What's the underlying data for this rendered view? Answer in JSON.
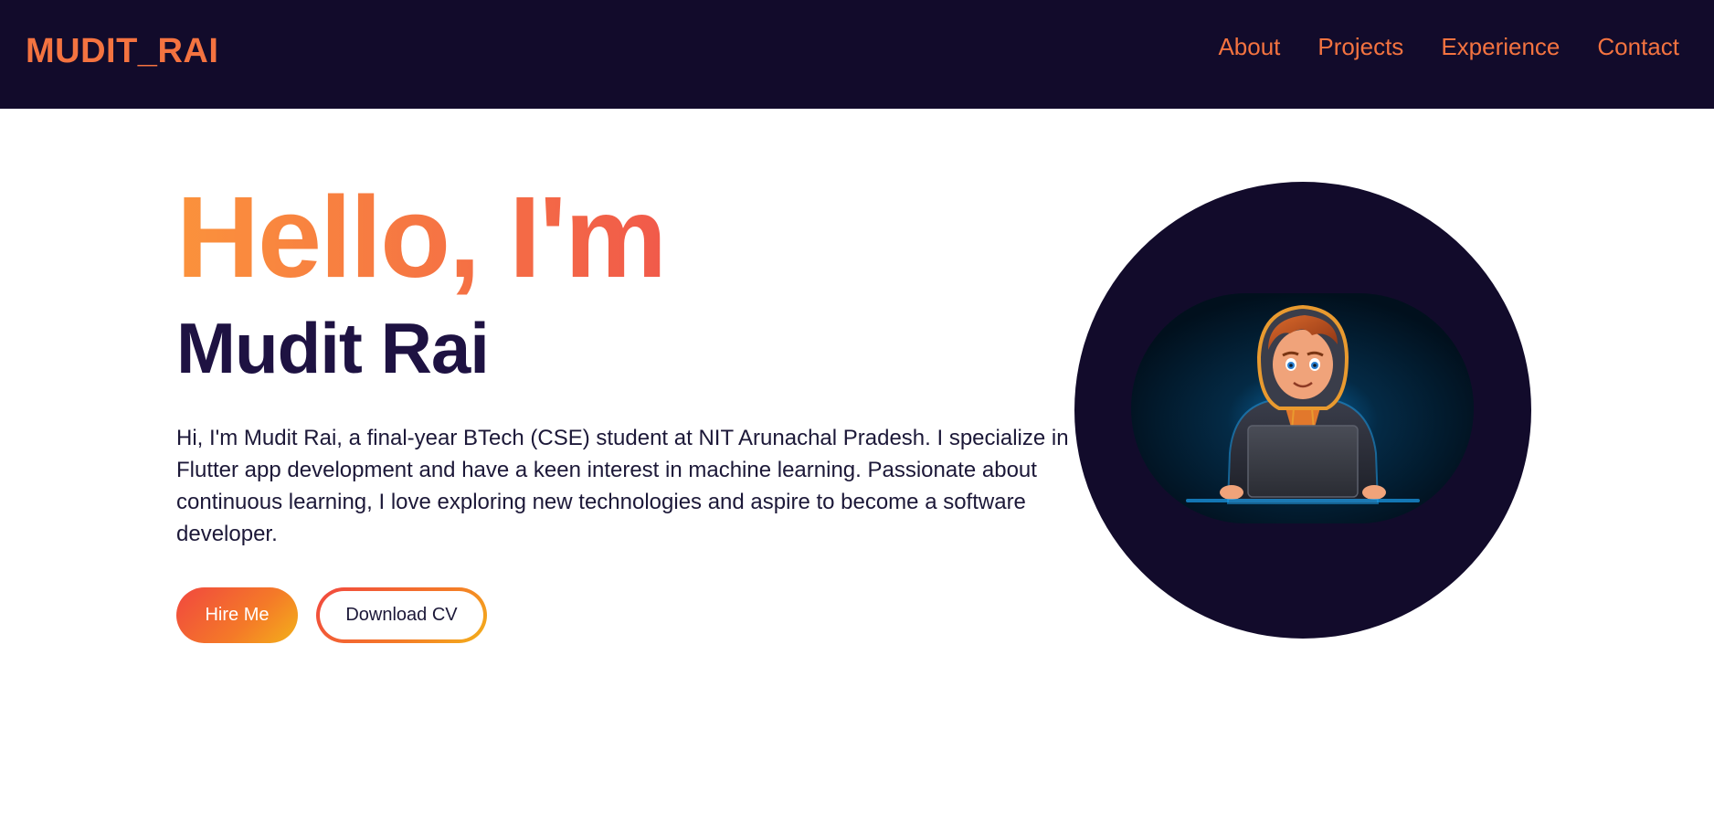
{
  "nav": {
    "brand": "MUDIT_RAI",
    "links": [
      "About",
      "Projects",
      "Experience",
      "Contact"
    ]
  },
  "hero": {
    "greeting": "Hello, I'm",
    "name": "Mudit Rai",
    "bio": "Hi, I'm Mudit Rai, a final-year BTech (CSE) student at NIT Arunachal Pradesh. I specialize in Flutter app development and have a keen interest in machine learning. Passionate about continuous learning, I love exploring new technologies and aspire to become a software developer.",
    "hire_label": "Hire Me",
    "cv_label": "Download CV",
    "avatar_icon": "avatar-illustration"
  },
  "colors": {
    "nav_bg": "#120b2b",
    "accent": "#f47340",
    "name_color": "#1e1242"
  }
}
